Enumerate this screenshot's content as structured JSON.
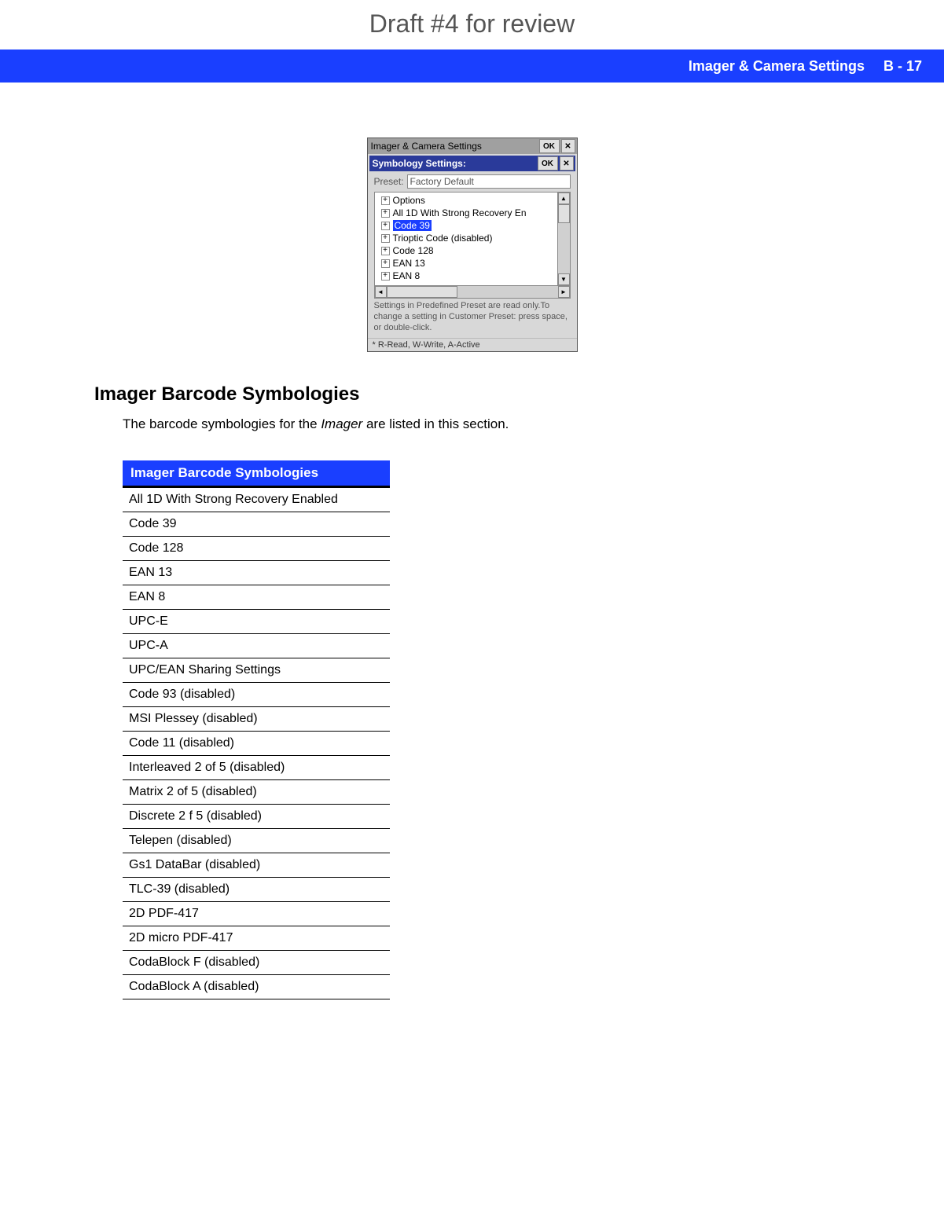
{
  "draft_title": "Draft #4 for review",
  "header": {
    "section": "Imager & Camera Settings",
    "page": "B - 17"
  },
  "dialog": {
    "outer_title": "Imager & Camera Settings",
    "inner_title": "Symbology Settings:",
    "ok_label": "OK",
    "close_label": "✕",
    "preset_label": "Preset:",
    "preset_value": "Factory Default",
    "tree_items": [
      "Options",
      "All 1D With Strong Recovery En",
      "Code 39",
      "Trioptic Code (disabled)",
      "Code 128",
      "EAN 13",
      "EAN 8"
    ],
    "selected_index": 2,
    "hint": "Settings in Predefined Preset are read only.To change a setting in Customer Preset: press space, or double-click.",
    "footer": "* R-Read, W-Write, A-Active"
  },
  "section_heading": "Imager Barcode Symbologies",
  "body_prefix": "The barcode symbologies for the ",
  "body_em": "Imager",
  "body_suffix": " are listed in this section.",
  "table": {
    "header": "Imager Barcode Symbologies",
    "rows": [
      "All 1D With Strong Recovery Enabled",
      "Code 39",
      "Code 128",
      "EAN 13",
      "EAN 8",
      "UPC-E",
      "UPC-A",
      "UPC/EAN Sharing Settings",
      "Code 93 (disabled)",
      "MSI Plessey (disabled)",
      "Code 11 (disabled)",
      "Interleaved 2 of 5 (disabled)",
      "Matrix 2 of 5 (disabled)",
      "Discrete 2 f 5 (disabled)",
      "Telepen (disabled)",
      "Gs1 DataBar (disabled)",
      "TLC-39 (disabled)",
      "2D PDF-417",
      "2D micro PDF-417",
      "CodaBlock F (disabled)",
      "CodaBlock A (disabled)"
    ]
  }
}
